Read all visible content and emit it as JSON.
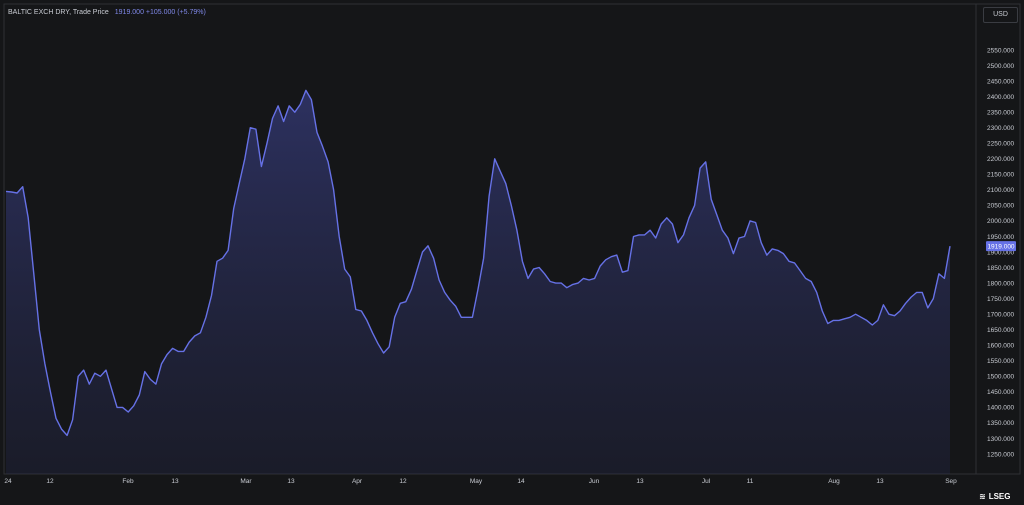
{
  "header": {
    "instrument": "BALTIC EXCH DRY, Trade Price",
    "change": "1919.000  +105.000 (+5.79%)"
  },
  "currency": "USD",
  "logo": {
    "mark": "≋",
    "text": "LSEG"
  },
  "colors": {
    "background": "#151618",
    "line": "#6671e6",
    "price_tag": "#6671e6",
    "text": "#c9ccd3"
  },
  "chart_data": {
    "type": "area",
    "title": "",
    "xlabel": "",
    "ylabel": "",
    "ylim": [
      1200,
      2600
    ],
    "grid": false,
    "y_ticks": [
      "1250.000",
      "1300.000",
      "1350.000",
      "1400.000",
      "1450.000",
      "1500.000",
      "1550.000",
      "1600.000",
      "1650.000",
      "1700.000",
      "1750.000",
      "1800.000",
      "1850.000",
      "1900.000",
      "1950.000",
      "2000.000",
      "2050.000",
      "2100.000",
      "2150.000",
      "2200.000",
      "2250.000",
      "2300.000",
      "2350.000",
      "2400.000",
      "2450.000",
      "2500.000",
      "2550.000"
    ],
    "x_ticks": [
      "24",
      "12",
      "Feb",
      "13",
      "Mar",
      "13",
      "Apr",
      "12",
      "May",
      "14",
      "Jun",
      "13",
      "Jul",
      "11",
      "Aug",
      "13",
      "Sep"
    ],
    "last_price_label": "1919.000",
    "series": [
      {
        "values": [
          2095,
          2093,
          2090,
          2110,
          2010,
          1830,
          1650,
          1540,
          1450,
          1365,
          1330,
          1310,
          1360,
          1500,
          1520,
          1475,
          1510,
          1500,
          1520,
          1460,
          1400,
          1400,
          1385,
          1405,
          1440,
          1515,
          1490,
          1475,
          1540,
          1570,
          1590,
          1580,
          1580,
          1610,
          1630,
          1640,
          1690,
          1760,
          1870,
          1880,
          1905,
          2040,
          2120,
          2200,
          2300,
          2295,
          2175,
          2250,
          2330,
          2370,
          2320,
          2370,
          2350,
          2375,
          2420,
          2390,
          2285,
          2240,
          2190,
          2100,
          1950,
          1845,
          1820,
          1715,
          1710,
          1680,
          1640,
          1605,
          1575,
          1595,
          1690,
          1735,
          1740,
          1780,
          1840,
          1900,
          1920,
          1880,
          1810,
          1770,
          1745,
          1725,
          1690,
          1690,
          1690,
          1780,
          1880,
          2080,
          2200,
          2160,
          2120,
          2050,
          1970,
          1870,
          1815,
          1845,
          1850,
          1830,
          1805,
          1800,
          1800,
          1785,
          1795,
          1800,
          1815,
          1810,
          1815,
          1855,
          1875,
          1885,
          1890,
          1835,
          1840,
          1950,
          1955,
          1955,
          1970,
          1945,
          1990,
          2010,
          1990,
          1930,
          1955,
          2010,
          2050,
          2170,
          2190,
          2070,
          2020,
          1970,
          1945,
          1895,
          1945,
          1950,
          2000,
          1995,
          1930,
          1890,
          1910,
          1905,
          1895,
          1870,
          1865,
          1840,
          1815,
          1805,
          1770,
          1710,
          1670,
          1680,
          1680,
          1685,
          1690,
          1700,
          1690,
          1680,
          1665,
          1680,
          1730,
          1700,
          1695,
          1710,
          1735,
          1755,
          1770,
          1770,
          1720,
          1750,
          1830,
          1815,
          1919
        ]
      }
    ]
  }
}
